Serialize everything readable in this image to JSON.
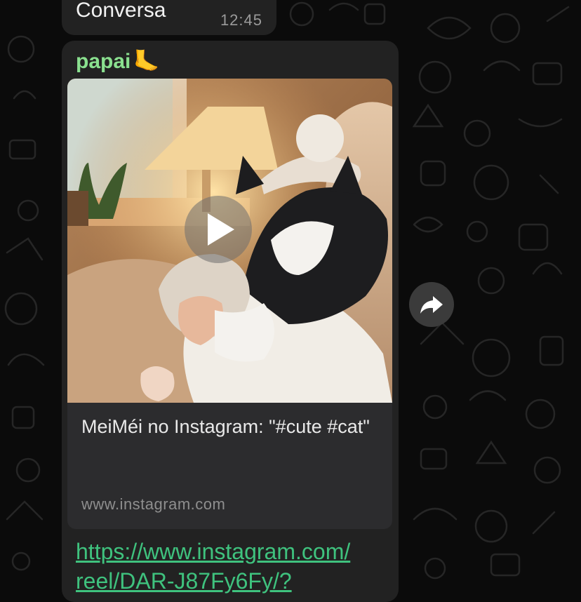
{
  "previous_message": {
    "text": "Conversa",
    "time": "12:45"
  },
  "message": {
    "sender": "papai",
    "sender_emoji": "🦶",
    "link_preview": {
      "title": "MeiMéi no Instagram: \"#cute #cat\"",
      "domain": "www.instagram.com",
      "media_type": "video",
      "play_icon": "play-icon"
    },
    "link_lines": [
      "https://www.instagram.com/",
      "reel/DAR-J87Fy6Fy/?"
    ]
  },
  "actions": {
    "forward_icon": "forward-icon"
  },
  "colors": {
    "background": "#0b0b0b",
    "bubble": "#222222",
    "sender_name": "#8ae08f",
    "link": "#3fc27e",
    "preview_card": "#2c2c2e"
  }
}
